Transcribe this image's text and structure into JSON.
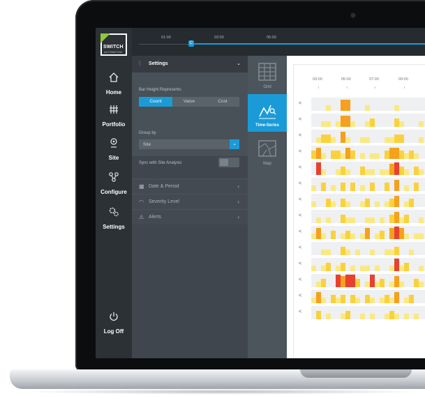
{
  "app": {
    "logo": {
      "word": "SWITCH",
      "sub": "AUTOMATION"
    },
    "nav": [
      {
        "label": "Home",
        "icon": "home-icon"
      },
      {
        "label": "Portfolio",
        "icon": "building-icon"
      },
      {
        "label": "Site",
        "icon": "map-pin-icon"
      },
      {
        "label": "Configure",
        "icon": "nodes-icon"
      },
      {
        "label": "Settings",
        "icon": "gears-icon"
      },
      {
        "label": "Log Off",
        "icon": "power-icon"
      }
    ]
  },
  "timeline": {
    "labels": [
      "01:00",
      "03:00",
      "05:00"
    ],
    "handle": "C",
    "accent": "#1a9bd7"
  },
  "settings": {
    "title": "Settings",
    "bar_height_label": "Bar Height Represents",
    "bar_height_options": [
      "Count",
      "Value",
      "Cost"
    ],
    "bar_height_selected": "Count",
    "group_by_label": "Group by",
    "group_by_value": "Site",
    "sync_label": "Sync with Site Analysis",
    "sections": [
      "Date & Period",
      "Severity Level",
      "Alerts"
    ]
  },
  "views": [
    {
      "label": "Grid",
      "icon": "grid-icon",
      "active": false
    },
    {
      "label": "Time-Series",
      "icon": "time-series-icon",
      "active": true
    },
    {
      "label": "Map",
      "icon": "map-icon",
      "active": false
    }
  ],
  "chart": {
    "time_labels": [
      "03:00",
      "05:00",
      "07:00",
      "09:00"
    ],
    "row_arrow": "<",
    "pager_first": "«",
    "pager_prev": "<",
    "colors": {
      "low": "#fce883",
      "medium": "#fbd13b",
      "high": "#f5a11d",
      "critical": "#e8412f",
      "empty": "#eef0f2"
    }
  },
  "chart_data": {
    "type": "heatmap",
    "x_labels": [
      "03:00",
      "05:00",
      "07:00",
      "09:00"
    ],
    "rows": 14,
    "levels": [
      "empty",
      "low",
      "medium",
      "high",
      "critical"
    ],
    "cells": [
      [
        0,
        0,
        0,
        1,
        0,
        0,
        3,
        3,
        0,
        0,
        0,
        1,
        0,
        0,
        0,
        0,
        0,
        1,
        0,
        0,
        0,
        0,
        0
      ],
      [
        0,
        0,
        1,
        1,
        0,
        1,
        3,
        3,
        1,
        0,
        0,
        1,
        2,
        0,
        0,
        0,
        0,
        2,
        1,
        0,
        0,
        0,
        1
      ],
      [
        0,
        1,
        2,
        2,
        1,
        0,
        3,
        1,
        0,
        0,
        1,
        1,
        0,
        0,
        0,
        1,
        1,
        2,
        2,
        0,
        0,
        0,
        1
      ],
      [
        2,
        3,
        1,
        0,
        2,
        2,
        1,
        3,
        2,
        0,
        1,
        0,
        1,
        1,
        0,
        2,
        3,
        3,
        2,
        1,
        2,
        1,
        0
      ],
      [
        0,
        4,
        1,
        0,
        0,
        1,
        2,
        1,
        0,
        0,
        2,
        1,
        1,
        0,
        1,
        1,
        3,
        4,
        2,
        1,
        0,
        2,
        1
      ],
      [
        1,
        0,
        2,
        0,
        1,
        0,
        2,
        0,
        2,
        0,
        1,
        0,
        2,
        0,
        0,
        2,
        0,
        3,
        0,
        1,
        0,
        2,
        0
      ],
      [
        1,
        0,
        0,
        2,
        1,
        0,
        2,
        1,
        0,
        0,
        1,
        2,
        0,
        1,
        0,
        1,
        2,
        3,
        0,
        1,
        2,
        0,
        0
      ],
      [
        0,
        1,
        0,
        1,
        0,
        0,
        2,
        1,
        1,
        0,
        0,
        1,
        1,
        0,
        1,
        0,
        2,
        3,
        1,
        2,
        0,
        0,
        1
      ],
      [
        1,
        3,
        1,
        0,
        2,
        0,
        1,
        2,
        1,
        0,
        1,
        3,
        0,
        1,
        2,
        0,
        3,
        4,
        3,
        1,
        0,
        1,
        1
      ],
      [
        0,
        0,
        1,
        1,
        0,
        0,
        2,
        1,
        0,
        1,
        0,
        0,
        1,
        0,
        0,
        1,
        1,
        2,
        0,
        0,
        1,
        0,
        0
      ],
      [
        1,
        0,
        1,
        2,
        0,
        1,
        2,
        0,
        1,
        0,
        1,
        1,
        0,
        1,
        0,
        0,
        1,
        4,
        1,
        2,
        0,
        0,
        1
      ],
      [
        0,
        1,
        2,
        0,
        0,
        4,
        3,
        4,
        4,
        2,
        0,
        1,
        4,
        1,
        2,
        0,
        1,
        3,
        1,
        0,
        0,
        2,
        1
      ],
      [
        1,
        3,
        1,
        0,
        2,
        1,
        2,
        0,
        2,
        1,
        0,
        2,
        1,
        0,
        1,
        2,
        1,
        3,
        0,
        1,
        2,
        0,
        0
      ],
      [
        0,
        2,
        0,
        1,
        0,
        0,
        1,
        2,
        0,
        0,
        1,
        0,
        1,
        0,
        0,
        1,
        2,
        1,
        0,
        1,
        0,
        1,
        0
      ]
    ]
  }
}
